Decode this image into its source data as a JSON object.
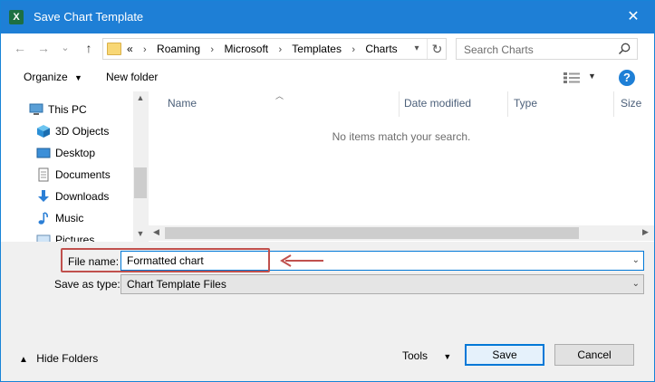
{
  "window": {
    "title": "Save Chart Template",
    "app_icon_letter": "X",
    "close_glyph": "✕"
  },
  "navbar": {
    "back_glyph": "←",
    "forward_glyph": "→",
    "recent_glyph": "⌄",
    "up_glyph": "↑",
    "breadcrumbs": [
      "«",
      "Roaming",
      "Microsoft",
      "Templates",
      "Charts"
    ],
    "refresh_glyph": "↻",
    "search_placeholder": "Search Charts"
  },
  "toolbar": {
    "organize": "Organize",
    "new_folder": "New folder",
    "help": "?"
  },
  "sidebar": {
    "items": [
      {
        "label": "This PC",
        "icon": "computer-icon"
      },
      {
        "label": "3D Objects",
        "icon": "cube-icon"
      },
      {
        "label": "Desktop",
        "icon": "desktop-icon"
      },
      {
        "label": "Documents",
        "icon": "documents-icon"
      },
      {
        "label": "Downloads",
        "icon": "download-icon"
      },
      {
        "label": "Music",
        "icon": "music-icon"
      },
      {
        "label": "Pictures",
        "icon": "pictures-icon"
      }
    ]
  },
  "file_list": {
    "columns": [
      "Name",
      "Date modified",
      "Type",
      "Size"
    ],
    "empty_message": "No items match your search."
  },
  "form": {
    "file_name_label": "File name:",
    "file_name_value": "Formatted chart",
    "save_type_label": "Save as type:",
    "save_type_value": "Chart Template Files"
  },
  "footer": {
    "hide_folders": "Hide Folders",
    "tools": "Tools",
    "save": "Save",
    "cancel": "Cancel"
  },
  "colors": {
    "titlebar": "#1e7fd6",
    "annotation": "#c0504d"
  }
}
